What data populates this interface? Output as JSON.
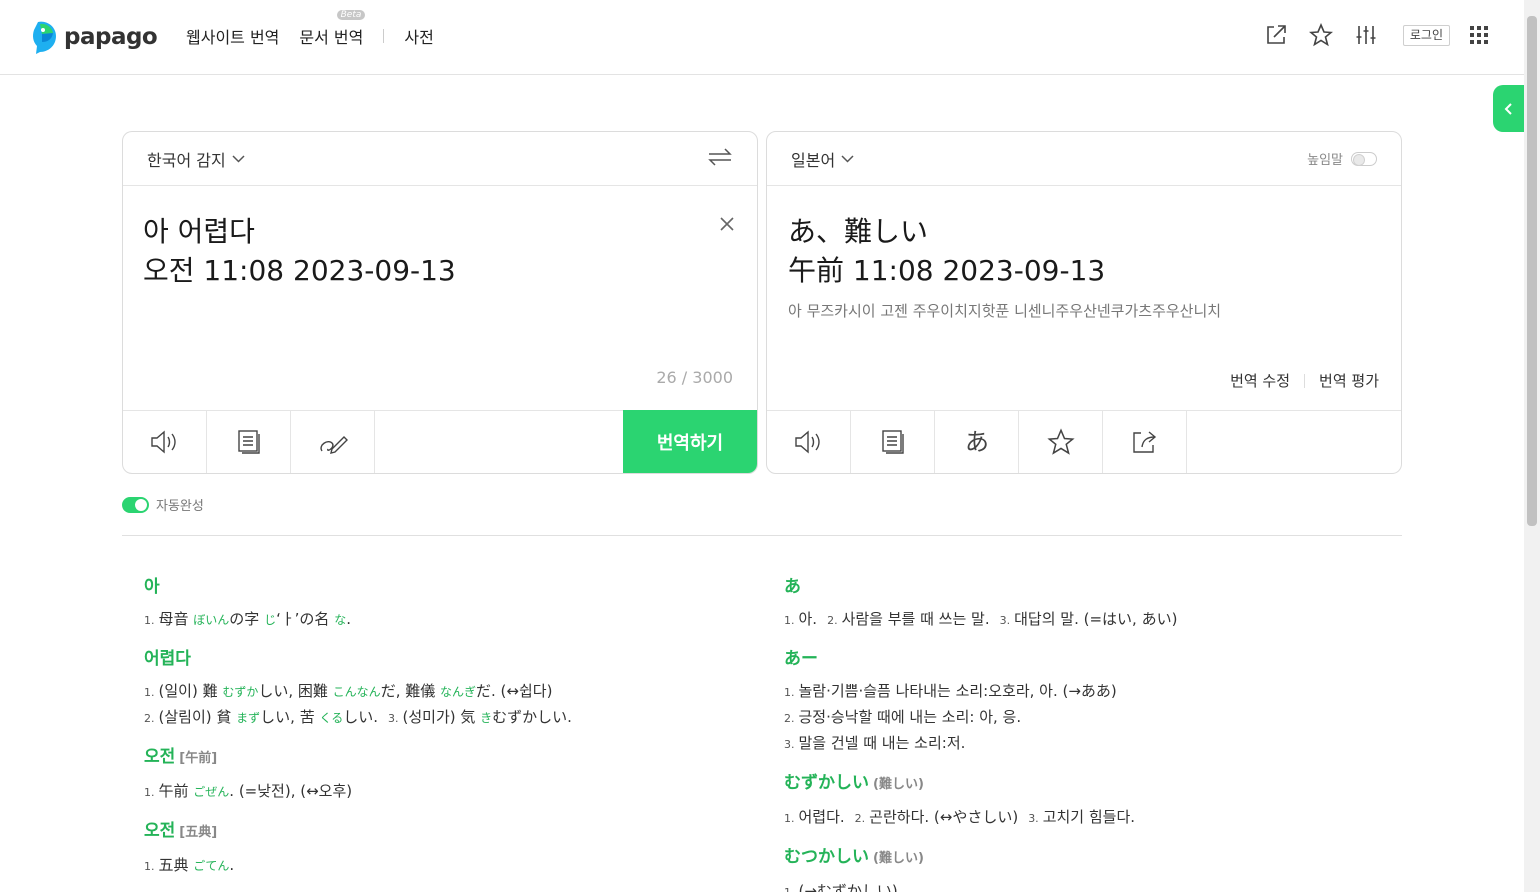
{
  "header": {
    "logo_text": "papago",
    "nav": {
      "website": "웹사이트 번역",
      "document": "문서 번역",
      "beta": "Beta",
      "dictionary": "사전"
    },
    "login": "로그인"
  },
  "source": {
    "language": "한국어 감지",
    "line1": "아 어렵다",
    "line2": "오전 11:08 2023-09-13",
    "counter": "26 / 3000",
    "translate_button": "번역하기"
  },
  "target": {
    "language": "일본어",
    "honorific": "높임말",
    "line1": "あ、難しい",
    "line2": "午前 11:08 2023-09-13",
    "pronunciation": "아 무즈카시이 고젠 주우이치지핫푼 니센니주우산넨쿠가츠주우산니치",
    "edit": "번역 수정",
    "rate": "번역 평가"
  },
  "autocomplete": "자동완성",
  "dictionary": {
    "left": [
      {
        "word": "아",
        "hanja": "",
        "defs": [
          {
            "n": "1.",
            "parts": [
              "母音 ",
              "ぼいん",
              "の字 ",
              "じ",
              "‘ㅏ’の名 ",
              "な",
              "."
            ]
          }
        ]
      },
      {
        "word": "어렵다",
        "hanja": "",
        "defs": [
          {
            "n": "1.",
            "parts": [
              "(일이) 難 ",
              "むずか",
              "しい, 困難 ",
              "こんなん",
              "だ, 難儀 ",
              "なんぎ",
              "だ. (↔쉽다)"
            ]
          },
          {
            "n": "2.",
            "parts": [
              "(살림이) 貧 ",
              "まず",
              "しい, 苦 ",
              "くる",
              "しい."
            ],
            "n2": "3.",
            "tail": [
              "(성미가) 気 ",
              "き",
              "むずかしい."
            ]
          }
        ]
      },
      {
        "word": "오전",
        "hanja": "[午前]",
        "defs": [
          {
            "n": "1.",
            "parts": [
              "午前 ",
              "ごぜん",
              ". (=낮전), (↔오후)"
            ]
          }
        ]
      },
      {
        "word": "오전",
        "hanja": "[五典]",
        "defs": [
          {
            "n": "1.",
            "parts": [
              "五典 ",
              "ごてん",
              "."
            ]
          }
        ]
      }
    ],
    "right": [
      {
        "word": "あ",
        "hanja": "",
        "defs": [
          {
            "n": "1.",
            "parts": [
              "아."
            ],
            "n2": "2.",
            "tail": [
              "사람을 부를 때 쓰는 말."
            ],
            "n3": "3.",
            "tail3": "대답의 말. (=はい, あい)"
          }
        ]
      },
      {
        "word": "あー",
        "hanja": "",
        "defs": [
          {
            "n": "1.",
            "parts": [
              "놀람·기쁨·슬픔 나타내는 소리:오호라, 아. (→ああ)"
            ]
          },
          {
            "n": "2.",
            "parts": [
              "긍정·승낙할 때에 내는 소리: 아, 응."
            ]
          },
          {
            "n": "3.",
            "parts": [
              "말을 건넬 때 내는 소리:저."
            ]
          }
        ]
      },
      {
        "word": "むずかしい",
        "hanja": "(難しい)",
        "defs": [
          {
            "n": "1.",
            "parts": [
              "어렵다."
            ],
            "n2": "2.",
            "tail": [
              "곤란하다. (↔やさしい)"
            ],
            "n3": "3.",
            "tail3": "고치기 힘들다."
          }
        ]
      },
      {
        "word": "むつかしい",
        "hanja": "(難しい)",
        "defs": [
          {
            "n": "1.",
            "parts": [
              "(→むずかしい)"
            ]
          }
        ]
      }
    ]
  },
  "colors": {
    "accent": "#2bd471",
    "dict_green": "#24b358"
  }
}
